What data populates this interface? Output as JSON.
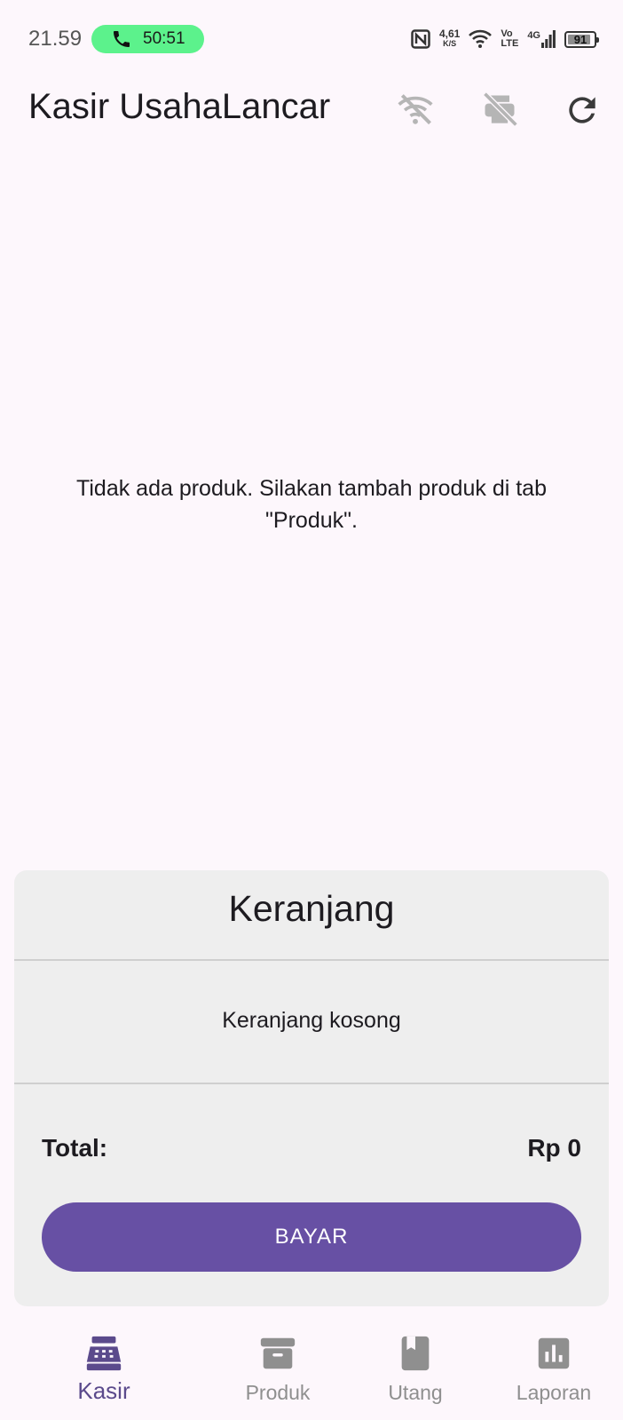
{
  "status_bar": {
    "time": "21.59",
    "call_timer": "50:51",
    "net_speed_value": "4,61",
    "net_speed_unit": "K/S",
    "volte_top": "Vo",
    "volte_bottom": "LTE",
    "network_type": "4G",
    "battery_level": "91",
    "battery_percent": 91,
    "call_pill_color": "#5cf28c"
  },
  "app_bar": {
    "title": "Kasir UsahaLancar",
    "actions": [
      {
        "icon": "wifi-off-icon"
      },
      {
        "icon": "print-disabled-icon"
      },
      {
        "icon": "refresh-icon"
      }
    ]
  },
  "products": {
    "empty_message": "Tidak ada produk. Silakan tambah produk di tab \"Produk\"."
  },
  "cart": {
    "title": "Keranjang",
    "empty_message": "Keranjang kosong",
    "total_label": "Total:",
    "total_value": "Rp 0",
    "pay_label": "BAYAR",
    "pay_color": "#6750a4"
  },
  "bottom_nav": {
    "items": [
      {
        "label": "Kasir",
        "icon": "cash-register-icon",
        "active": true
      },
      {
        "label": "Produk",
        "icon": "archive-box-icon",
        "active": false
      },
      {
        "label": "Utang",
        "icon": "book-icon",
        "active": false
      },
      {
        "label": "Laporan",
        "icon": "bar-chart-icon",
        "active": false
      }
    ],
    "active_color": "#5b4a8c",
    "inactive_color": "#8f8f8f"
  }
}
